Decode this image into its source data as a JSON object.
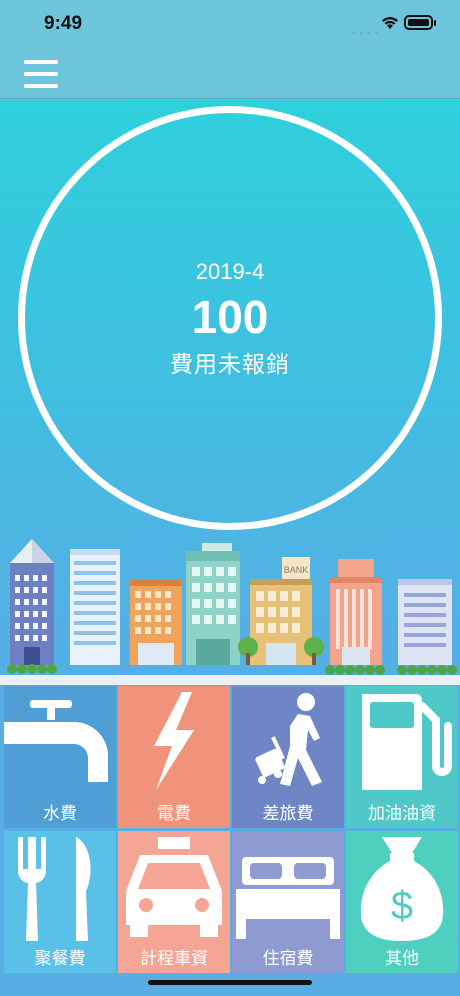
{
  "status_bar": {
    "time": "9:49"
  },
  "summary": {
    "period": "2019-4",
    "count": "100",
    "label": "費用未報銷"
  },
  "categories": [
    {
      "label": "水費",
      "icon": "faucet-icon",
      "color": "#4f9fd6"
    },
    {
      "label": "電費",
      "icon": "lightning-icon",
      "color": "#f0937a"
    },
    {
      "label": "差旅費",
      "icon": "traveler-icon",
      "color": "#6f86c6"
    },
    {
      "label": "加油油資",
      "icon": "gas-pump-icon",
      "color": "#4ec8c8"
    },
    {
      "label": "聚餐費",
      "icon": "fork-knife-icon",
      "color": "#5bc0e8"
    },
    {
      "label": "計程車資",
      "icon": "taxi-icon",
      "color": "#f4a593"
    },
    {
      "label": "住宿費",
      "icon": "bed-icon",
      "color": "#8e9bd3"
    },
    {
      "label": "其他",
      "icon": "money-bag-icon",
      "color": "#4fcfc0"
    }
  ],
  "city": {
    "bank_sign": "BANK"
  }
}
